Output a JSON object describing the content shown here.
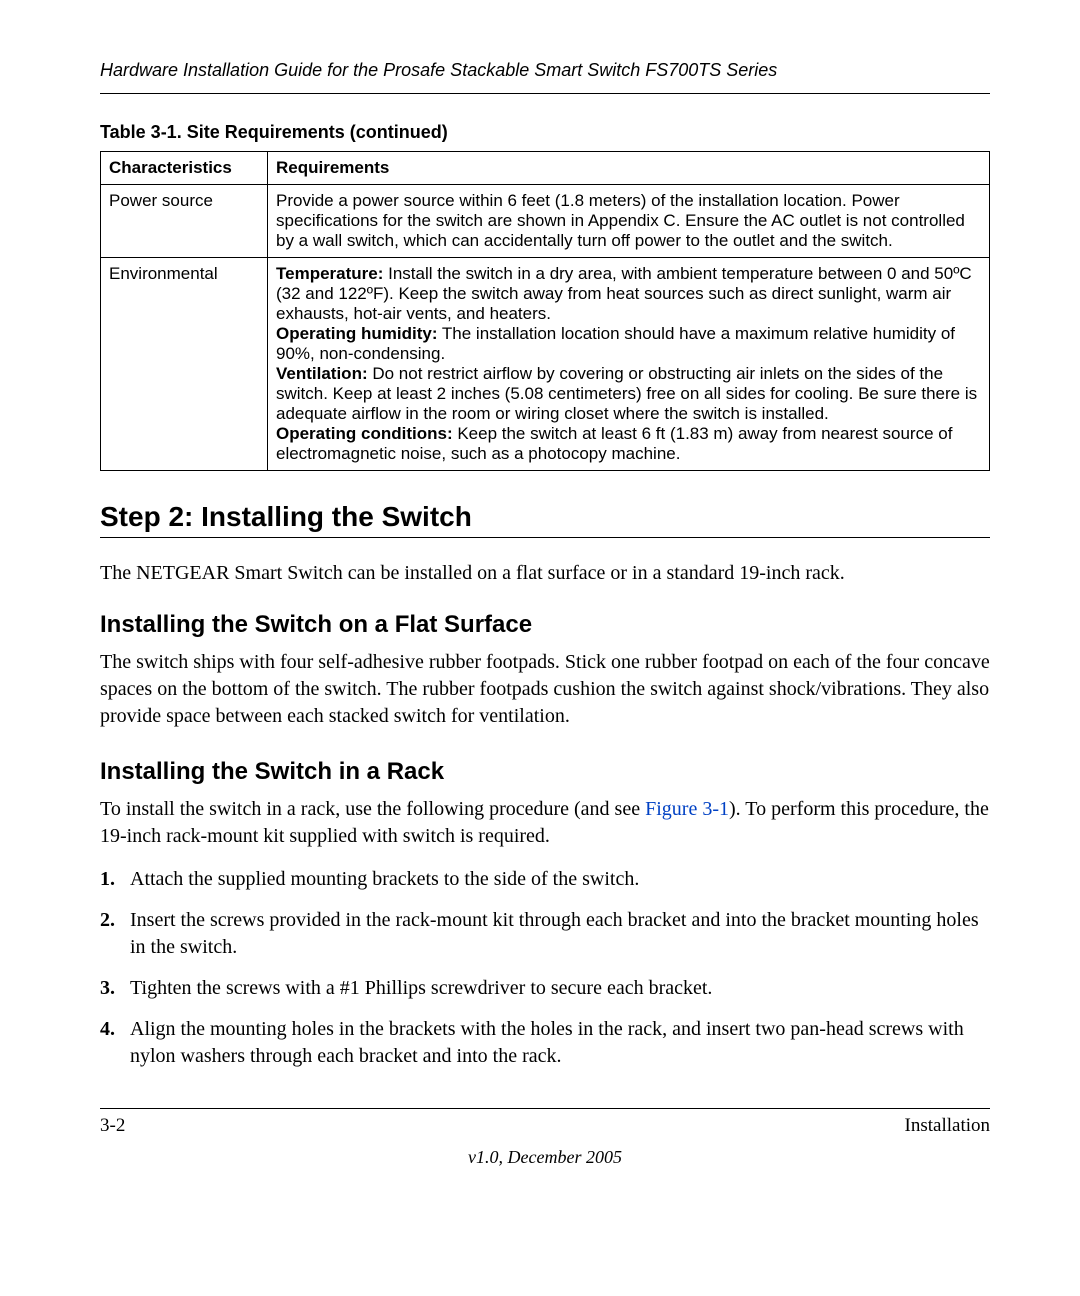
{
  "running_head": "Hardware Installation Guide for the Prosafe Stackable Smart Switch FS700TS Series",
  "table": {
    "caption": "Table 3-1. Site Requirements (continued)",
    "header": {
      "col1": "Characteristics",
      "col2": "Requirements"
    },
    "rows": [
      {
        "char": "Power source",
        "req": "Provide a power source within 6 feet (1.8 meters) of the installation location. Power specifications for the switch are shown in Appendix C. Ensure the AC outlet is not controlled by a wall switch, which can accidentally turn off power to the outlet and the switch."
      },
      {
        "char": "Environmental",
        "segments": [
          {
            "label": "Temperature:",
            "text": " Install the switch in a dry area, with ambient temperature between 0 and 50ºC (32 and 122ºF). Keep the switch away from heat sources such as direct sunlight, warm air exhausts, hot-air vents, and heaters."
          },
          {
            "label": "Operating humidity:",
            "text": " The installation location should have a maximum relative humidity of 90%, non-condensing."
          },
          {
            "label": "Ventilation:",
            "text": " Do not restrict airflow by covering or obstructing air inlets on the sides of the switch. Keep at least 2 inches (5.08 centimeters) free on all sides for cooling. Be sure there is adequate airflow in the room or wiring closet where the switch is installed."
          },
          {
            "label": "Operating conditions:",
            "text": " Keep the switch at least 6 ft (1.83 m) away from nearest source of electromagnetic noise, such as a photocopy machine."
          }
        ]
      }
    ]
  },
  "step_heading": "Step 2: Installing the Switch",
  "step_intro": "The NETGEAR Smart Switch can be installed on a flat surface or in a standard 19-inch rack.",
  "flat": {
    "heading": "Installing the Switch on a Flat Surface",
    "text": "The switch ships with four self-adhesive rubber footpads. Stick one rubber footpad on each of the four concave spaces on the bottom of the switch. The rubber footpads cushion the switch against shock/vibrations. They also provide space between each stacked switch for ventilation."
  },
  "rack": {
    "heading": "Installing the Switch in a Rack",
    "intro_pre": "To install the switch in a rack, use the following procedure (and see ",
    "figure_ref": "Figure 3-1",
    "intro_post": "). To perform this procedure, the 19-inch rack-mount kit supplied with switch is required.",
    "steps": [
      "Attach the supplied mounting brackets to the side of the switch.",
      "Insert the screws provided in the rack-mount kit through each bracket and into the bracket mounting holes in the switch.",
      "Tighten the screws with a #1 Phillips screwdriver to secure each bracket.",
      "Align the mounting holes in the brackets with the holes in the rack, and insert two pan-head screws with nylon washers through each bracket and into the rack."
    ],
    "markers": [
      "1.",
      "2.",
      "3.",
      "4."
    ]
  },
  "footer": {
    "left": "3-2",
    "right": "Installation",
    "version": "v1.0, December 2005"
  }
}
